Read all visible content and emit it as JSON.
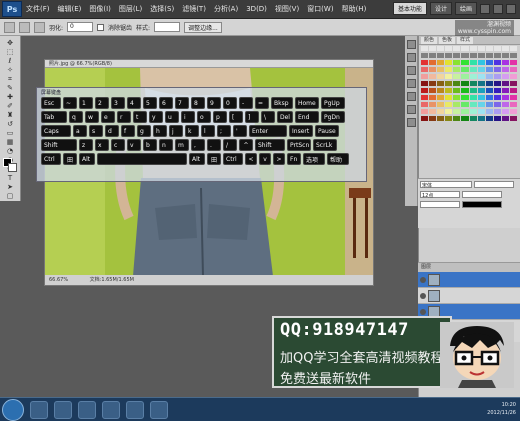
{
  "menubar": {
    "logo": "Ps",
    "menus": [
      "文件(F)",
      "编辑(E)",
      "图像(I)",
      "图层(L)",
      "选择(S)",
      "滤镜(T)",
      "分析(A)",
      "3D(D)",
      "视图(V)",
      "窗口(W)",
      "帮助(H)"
    ],
    "workspace": {
      "basic": "基本功能",
      "design": "设计",
      "painting": "绘画"
    }
  },
  "options_bar": {
    "feather_label": "羽化:",
    "feather_value": "0",
    "antialias_label": "消除锯齿",
    "style_label": "样式:",
    "refine_label": "调整边缘..."
  },
  "watermark": {
    "line1": "溜渊视频",
    "line2": "www.cysspin.com"
  },
  "document": {
    "title": "照片.jpg @ 66.7%(RGB/8)",
    "zoom": "66.67%",
    "doc_info": "文档:1.65M/1.65M"
  },
  "keyboard": {
    "title": "屏幕键盘",
    "rows": [
      [
        "Esc",
        "~",
        "1",
        "2",
        "3",
        "4",
        "5",
        "6",
        "7",
        "8",
        "9",
        "0",
        "-",
        "=",
        "Bksp",
        "Home",
        "PgUp"
      ],
      [
        "Tab",
        "q",
        "w",
        "e",
        "r",
        "t",
        "y",
        "u",
        "i",
        "o",
        "p",
        "[",
        "]",
        "\\",
        "Del",
        "End",
        "PgDn"
      ],
      [
        "Caps",
        "a",
        "s",
        "d",
        "f",
        "g",
        "h",
        "j",
        "k",
        "l",
        ";",
        "'",
        "Enter",
        "Insert",
        "Pause"
      ],
      [
        "Shift",
        "z",
        "x",
        "c",
        "v",
        "b",
        "n",
        "m",
        ",",
        ".",
        "/",
        "^",
        "Shift",
        "PrtScn",
        "ScrLk"
      ],
      [
        "Ctrl",
        "田",
        "Alt",
        "",
        "Alt",
        "田",
        "Ctrl",
        "<",
        "v",
        ">",
        "Fn",
        "选项",
        "帮助"
      ]
    ]
  },
  "right_panel": {
    "tabs": [
      "颜色",
      "色板",
      "样式"
    ],
    "char_font": "宋体",
    "char_size": "12点",
    "layers_title": "图层"
  },
  "qq_banner": {
    "number": "QQ:918947147",
    "line1": "加QQ学习全套高清视频教程",
    "line2": "免费送最新软件"
  },
  "taskbar": {
    "time": "10:20",
    "date": "2012/11/26"
  },
  "colors": {
    "canvas_green": "#a4c23e",
    "banner_green": "#2b4a33",
    "layer_selected": "#3a74c6",
    "taskbar": "#1c3a5c"
  }
}
